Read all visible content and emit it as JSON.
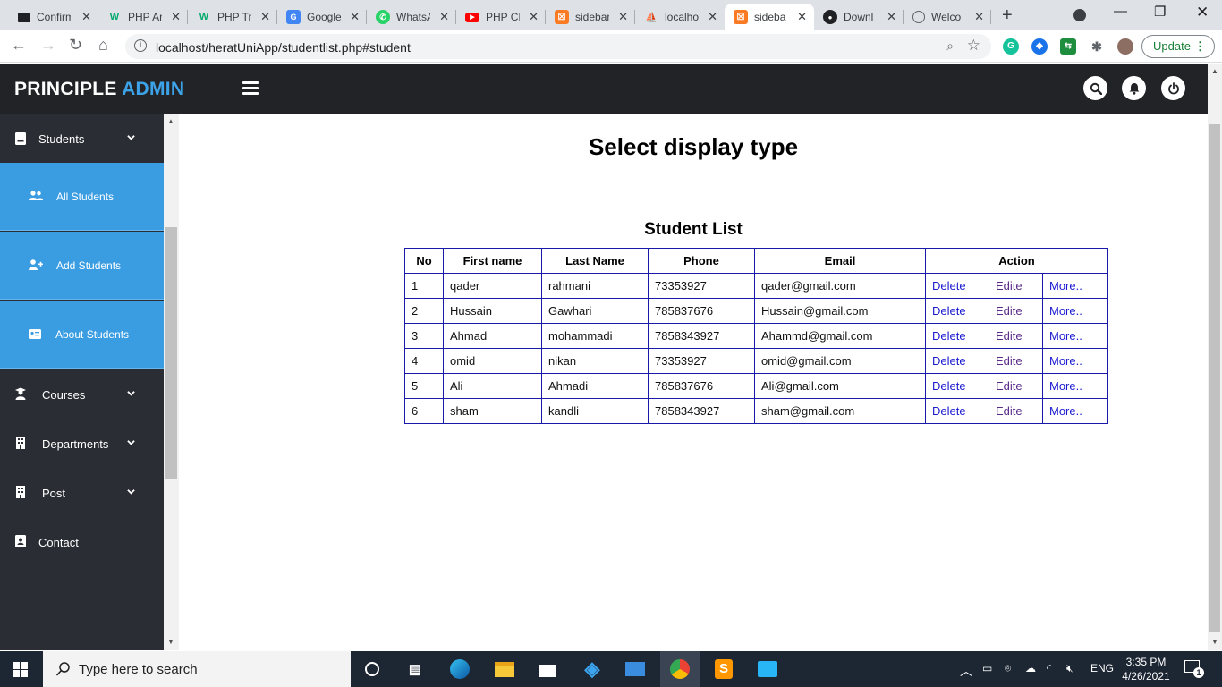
{
  "browser": {
    "tabs": [
      {
        "label": "Confirm",
        "icon": "mail-tab-icon",
        "color": "#202124"
      },
      {
        "label": "PHP Ar",
        "icon": "w3-tab-icon",
        "color": "#04aa6d"
      },
      {
        "label": "PHP Tr",
        "icon": "w3-tab-icon",
        "color": "#04aa6d"
      },
      {
        "label": "Google",
        "icon": "google-translate-icon",
        "color": "#4285f4"
      },
      {
        "label": "WhatsApp",
        "icon": "whatsapp-icon",
        "color": "#25d366"
      },
      {
        "label": "PHP CR",
        "icon": "youtube-icon",
        "color": "#ff0000"
      },
      {
        "label": "sidebar",
        "icon": "xampp-icon",
        "color": "#fb7a24"
      },
      {
        "label": "localhost",
        "icon": "phpmyadmin-icon",
        "color": "#f89c0e"
      },
      {
        "label": "sideba",
        "icon": "xampp-icon",
        "color": "#fb7a24",
        "active": true
      },
      {
        "label": "Downl",
        "icon": "github-icon",
        "color": "#202124"
      },
      {
        "label": "Welco",
        "icon": "globe-icon",
        "color": "#5f6368"
      }
    ],
    "url": "localhost/heratUniApp/studentlist.php#student",
    "update_label": "Update"
  },
  "header": {
    "brand_main": "PRINCIPLE",
    "brand_accent": "ADMIN"
  },
  "sidebar": {
    "items": [
      {
        "label": "Students"
      },
      {
        "label": "All Students"
      },
      {
        "label": "Add Students"
      },
      {
        "label": "About Students"
      },
      {
        "label": "Courses"
      },
      {
        "label": "Departments"
      },
      {
        "label": "Post"
      },
      {
        "label": "Contact"
      }
    ]
  },
  "main": {
    "page_title": "Select display type",
    "table_title": "Student List",
    "columns": [
      "No",
      "First name",
      "Last Name",
      "Phone",
      "Email",
      "Action"
    ],
    "rows": [
      {
        "no": "1",
        "first": "qader",
        "last": "rahmani",
        "phone": "73353927",
        "email": "qader@gmail.com"
      },
      {
        "no": "2",
        "first": "Hussain",
        "last": "Gawhari",
        "phone": "785837676",
        "email": "Hussain@gmail.com"
      },
      {
        "no": "3",
        "first": "Ahmad",
        "last": "mohammadi",
        "phone": "7858343927",
        "email": "Ahammd@gmail.com"
      },
      {
        "no": "4",
        "first": "omid",
        "last": "nikan",
        "phone": "73353927",
        "email": "omid@gmail.com"
      },
      {
        "no": "5",
        "first": "Ali",
        "last": "Ahmadi",
        "phone": "785837676",
        "email": "Ali@gmail.com"
      },
      {
        "no": "6",
        "first": "sham",
        "last": "kandli",
        "phone": "7858343927",
        "email": "sham@gmail.com"
      }
    ],
    "actions": {
      "delete": "Delete",
      "edit": "Edite",
      "more": "More.."
    }
  },
  "taskbar": {
    "search_placeholder": "Type here to search",
    "language": "ENG",
    "time": "3:35 PM",
    "date": "4/26/2021",
    "notification_count": "1"
  },
  "colors": {
    "header_bg": "#222327",
    "sidebar_bg": "#2a2d34",
    "sidebar_active": "#3a9de2",
    "brand_accent": "#3da3e8",
    "table_border": "#1a1aa8"
  }
}
